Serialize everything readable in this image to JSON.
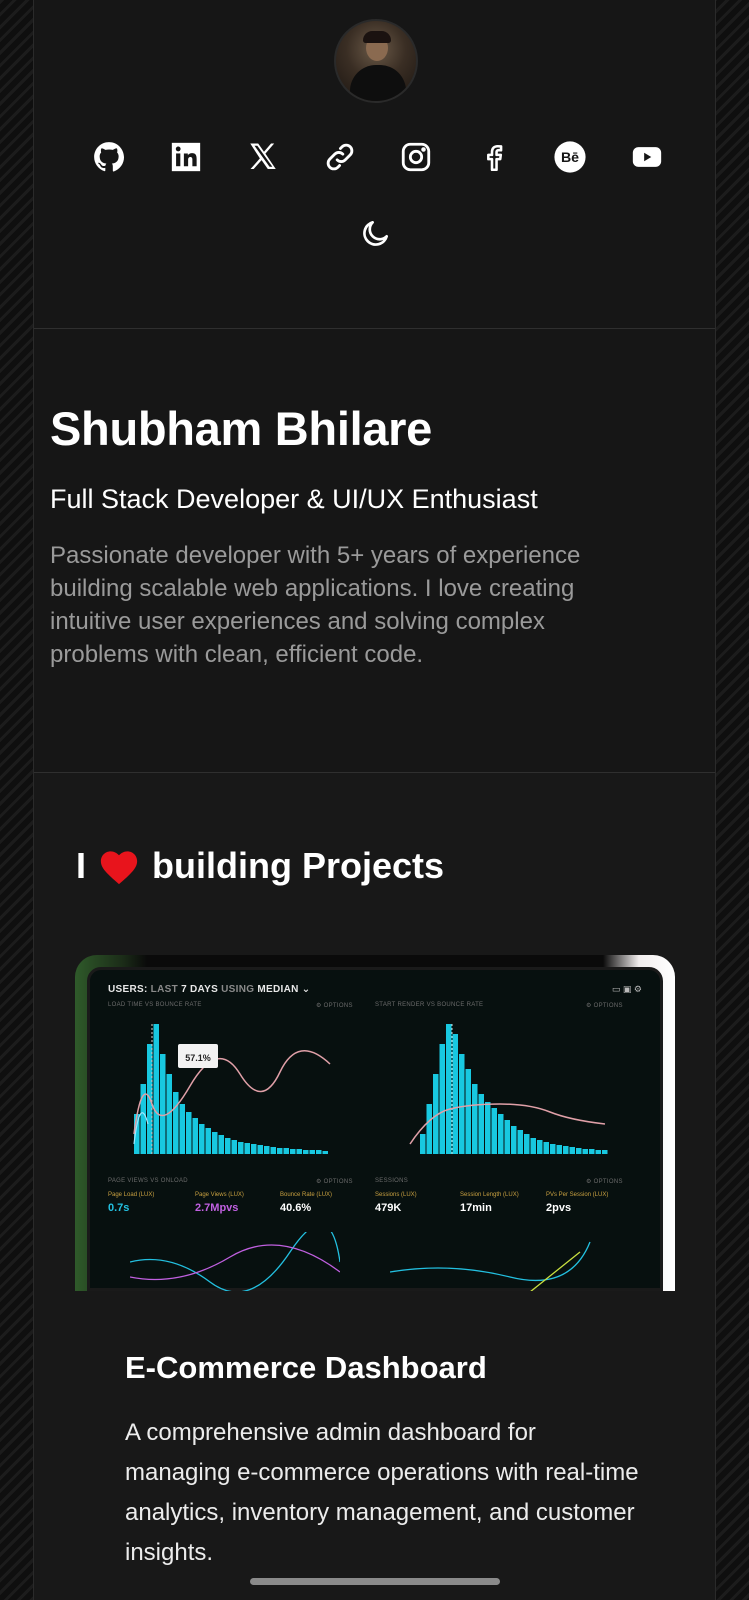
{
  "header": {
    "socials": [
      {
        "name": "github-icon"
      },
      {
        "name": "linkedin-icon"
      },
      {
        "name": "x-icon"
      },
      {
        "name": "link-icon"
      },
      {
        "name": "instagram-icon"
      },
      {
        "name": "facebook-icon"
      },
      {
        "name": "behance-icon",
        "label": "Bē"
      },
      {
        "name": "youtube-icon"
      }
    ],
    "theme_toggle_icon": "moon-icon"
  },
  "intro": {
    "name": "Shubham Bhilare",
    "role": "Full Stack Developer & UI/UX Enthusiast",
    "bio": "Passionate developer with 5+ years of experience building scalable web applications. I love creating intuitive user experiences and solving complex problems with clean, efficient code."
  },
  "projects": {
    "heading_prefix": "I",
    "heading_icon": "heart-icon",
    "heading_suffix": "building Projects",
    "items": [
      {
        "title": "E-Commerce Dashboard",
        "description": "A comprehensive admin dashboard for managing e-commerce operations with real-time analytics, inventory management, and customer insights.",
        "image": {
          "title_bold": "USERS:",
          "title_dim": " LAST ",
          "title_bold2": "7 DAYS",
          "title_dim2": " USING ",
          "title_bold3": "MEDIAN",
          "left_panel": "LOAD TIME VS BOUNCE RATE",
          "right_panel": "START RENDER VS BOUNCE RATE",
          "options": "⚙ OPTIONS",
          "callout": "57.1%",
          "lower_left_panel": "PAGE VIEWS VS ONLOAD",
          "lower_right_panel": "SESSIONS",
          "metrics": [
            {
              "label": "Page Load (LUX)",
              "value": "0.7s",
              "color": "#23c0e0"
            },
            {
              "label": "Page Views (LUX)",
              "value": "2.7Mpvs",
              "color": "#c060e0"
            },
            {
              "label": "Bounce Rate (LUX)",
              "value": "40.6%",
              "color": "#ffffff"
            },
            {
              "label": "Sessions (LUX)",
              "value": "479K",
              "color": "#ffffff"
            },
            {
              "label": "Session Length (LUX)",
              "value": "17min",
              "color": "#ffffff"
            },
            {
              "label": "PVs Per Session (LUX)",
              "value": "2pvs",
              "color": "#ffffff"
            }
          ]
        }
      }
    ]
  },
  "colors": {
    "background": "#141414",
    "column": "#161616",
    "bio_text": "#9a9a9a",
    "heart": "#e8141c",
    "chart_cyan": "#18c8e0",
    "chart_pink": "#e0a0a8"
  }
}
